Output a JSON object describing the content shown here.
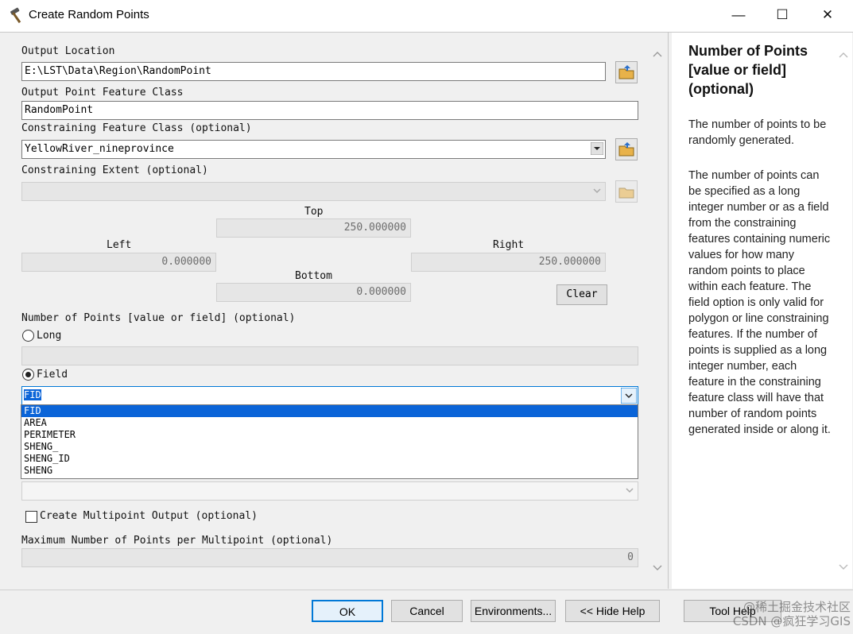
{
  "window": {
    "title": "Create Random Points",
    "minimize_glyph": "—",
    "maximize_glyph": "☐",
    "close_glyph": "✕",
    "app_icon": "hammer-icon"
  },
  "form": {
    "output_location_label": "Output Location",
    "output_location_value": "E:\\LST\\Data\\Region\\RandomPoint",
    "output_feature_class_label": "Output Point Feature Class",
    "output_feature_class_value": "RandomPoint",
    "constraining_fc_label": "Constraining Feature Class (optional)",
    "constraining_fc_value": "YellowRiver_nineprovince",
    "constraining_extent_label": "Constraining Extent (optional)",
    "constraining_extent_value": "",
    "extent": {
      "top_label": "Top",
      "top_value": "250.000000",
      "left_label": "Left",
      "left_value": "0.000000",
      "right_label": "Right",
      "right_value": "250.000000",
      "bottom_label": "Bottom",
      "bottom_value": "0.000000",
      "clear_label": "Clear"
    },
    "num_points_label": "Number of Points [value or field] (optional)",
    "long_label": "Long",
    "long_value": "",
    "field_label": "Field",
    "field_value": "FID",
    "field_options": [
      "FID",
      "AREA",
      "PERIMETER",
      "SHENG_",
      "SHENG_ID",
      "SHENG"
    ],
    "field_selected_index": 0,
    "multipoint_label": "Create Multipoint Output (optional)",
    "max_points_label": "Maximum Number of Points per Multipoint (optional)",
    "max_points_value": "0"
  },
  "help": {
    "title": "Number of Points [value or field] (optional)",
    "p1": "The number of points to be randomly generated.",
    "p2": "The number of points can be specified as a long integer number or as a field from the constraining features containing numeric values for how many random points to place within each feature. The field option is only valid for polygon or line constraining features. If the number of points is supplied as a long integer number, each feature in the constraining feature class will have that number of random points generated inside or along it."
  },
  "buttons": {
    "ok": "OK",
    "cancel": "Cancel",
    "environments": "Environments...",
    "hide_help": "<< Hide Help",
    "tool_help": "Tool Help"
  },
  "watermark": "@稀土掘金技术社区\nCSDN @疯狂学习GIS",
  "colors": {
    "selection": "#0a64d8",
    "focus_border": "#0078d7",
    "folder": "#e8b24a"
  }
}
